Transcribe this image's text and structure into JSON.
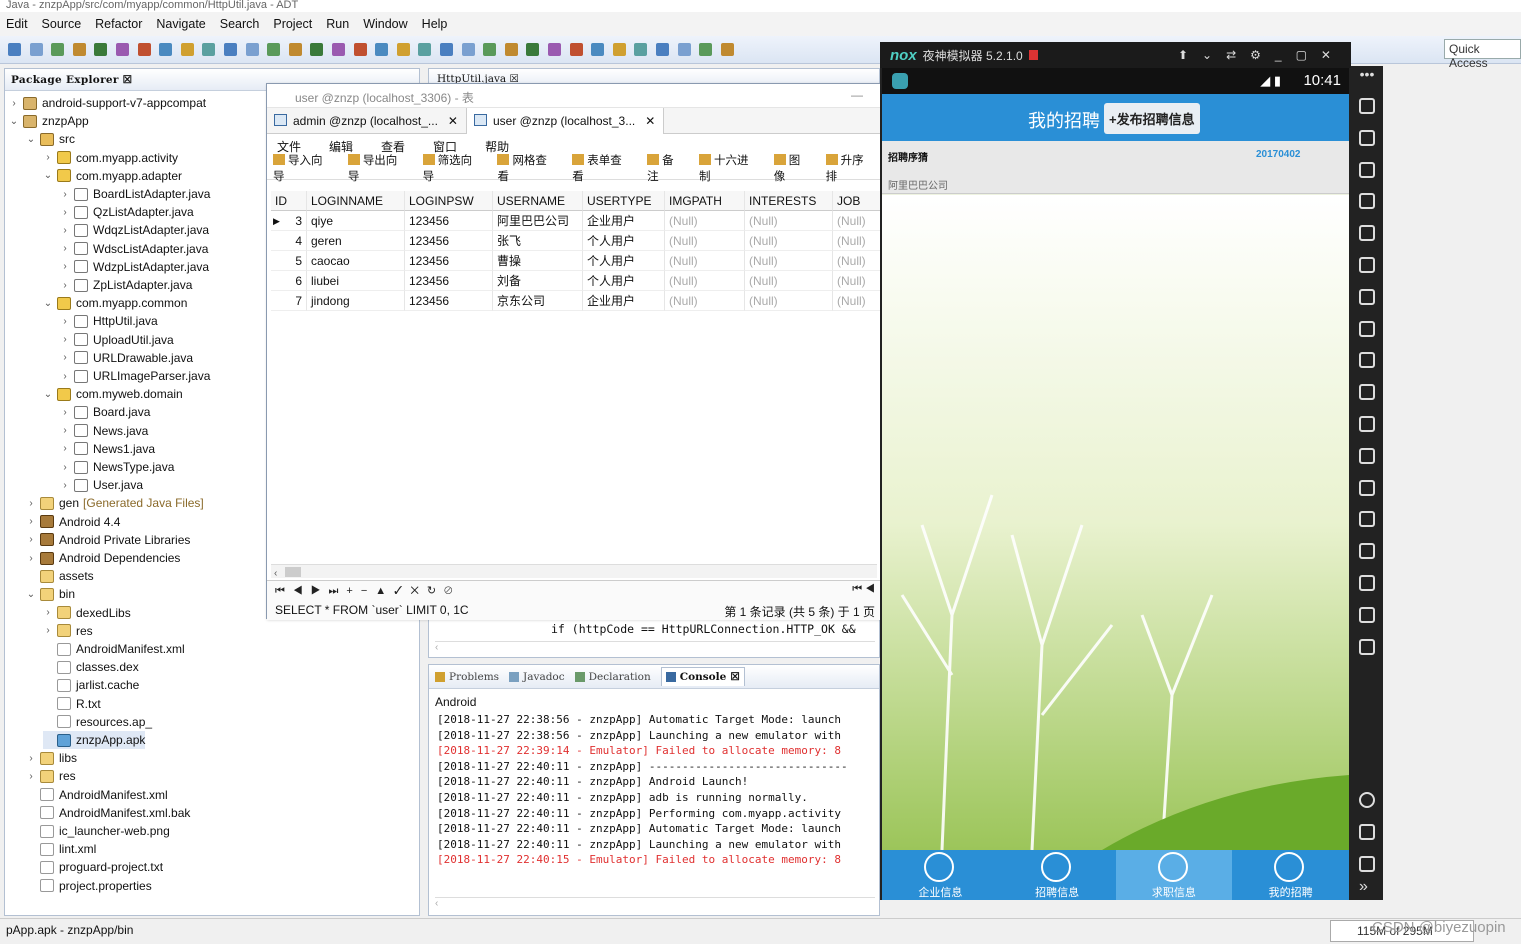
{
  "window": {
    "title": "Java - znzpApp/src/com/myapp/common/HttpUtil.java - ADT"
  },
  "menu": [
    "Edit",
    "Source",
    "Refactor",
    "Navigate",
    "Search",
    "Project",
    "Run",
    "Window",
    "Help"
  ],
  "quick_access": "Quick Access",
  "package_explorer": {
    "title": "Package Explorer",
    "rows": [
      {
        "label": "android-support-v7-appcompat",
        "depth": 0,
        "tw": "›",
        "icon": "proj"
      },
      {
        "label": "znzpApp",
        "depth": 0,
        "tw": "⌄",
        "icon": "proj"
      },
      {
        "label": "src",
        "depth": 1,
        "tw": "⌄",
        "icon": "src"
      },
      {
        "label": "com.myapp.activity",
        "depth": 2,
        "tw": "›",
        "icon": "pkg"
      },
      {
        "label": "com.myapp.adapter",
        "depth": 2,
        "tw": "⌄",
        "icon": "pkg"
      },
      {
        "label": "BoardListAdapter.java",
        "depth": 3,
        "tw": "›",
        "icon": "java"
      },
      {
        "label": "QzListAdapter.java",
        "depth": 3,
        "tw": "›",
        "icon": "java"
      },
      {
        "label": "WdqzListAdapter.java",
        "depth": 3,
        "tw": "›",
        "icon": "java"
      },
      {
        "label": "WdscListAdapter.java",
        "depth": 3,
        "tw": "›",
        "icon": "java"
      },
      {
        "label": "WdzpListAdapter.java",
        "depth": 3,
        "tw": "›",
        "icon": "java"
      },
      {
        "label": "ZpListAdapter.java",
        "depth": 3,
        "tw": "›",
        "icon": "java"
      },
      {
        "label": "com.myapp.common",
        "depth": 2,
        "tw": "⌄",
        "icon": "pkg"
      },
      {
        "label": "HttpUtil.java",
        "depth": 3,
        "tw": "›",
        "icon": "java"
      },
      {
        "label": "UploadUtil.java",
        "depth": 3,
        "tw": "›",
        "icon": "java"
      },
      {
        "label": "URLDrawable.java",
        "depth": 3,
        "tw": "›",
        "icon": "java"
      },
      {
        "label": "URLImageParser.java",
        "depth": 3,
        "tw": "›",
        "icon": "java"
      },
      {
        "label": "com.myweb.domain",
        "depth": 2,
        "tw": "⌄",
        "icon": "pkg"
      },
      {
        "label": "Board.java",
        "depth": 3,
        "tw": "›",
        "icon": "java"
      },
      {
        "label": "News.java",
        "depth": 3,
        "tw": "›",
        "icon": "java"
      },
      {
        "label": "News1.java",
        "depth": 3,
        "tw": "›",
        "icon": "java"
      },
      {
        "label": "NewsType.java",
        "depth": 3,
        "tw": "›",
        "icon": "java"
      },
      {
        "label": "User.java",
        "depth": 3,
        "tw": "›",
        "icon": "java"
      },
      {
        "label": "gen",
        "depth": 1,
        "tw": "›",
        "icon": "folder",
        "suffix": "[Generated Java Files]"
      },
      {
        "label": "Android 4.4",
        "depth": 1,
        "tw": "›",
        "icon": "lib"
      },
      {
        "label": "Android Private Libraries",
        "depth": 1,
        "tw": "›",
        "icon": "lib"
      },
      {
        "label": "Android Dependencies",
        "depth": 1,
        "tw": "›",
        "icon": "lib"
      },
      {
        "label": "assets",
        "depth": 1,
        "tw": "",
        "icon": "folder"
      },
      {
        "label": "bin",
        "depth": 1,
        "tw": "⌄",
        "icon": "folder"
      },
      {
        "label": "dexedLibs",
        "depth": 2,
        "tw": "›",
        "icon": "folder"
      },
      {
        "label": "res",
        "depth": 2,
        "tw": "›",
        "icon": "folder"
      },
      {
        "label": "AndroidManifest.xml",
        "depth": 2,
        "tw": "",
        "icon": "file"
      },
      {
        "label": "classes.dex",
        "depth": 2,
        "tw": "",
        "icon": "file"
      },
      {
        "label": "jarlist.cache",
        "depth": 2,
        "tw": "",
        "icon": "file"
      },
      {
        "label": "R.txt",
        "depth": 2,
        "tw": "",
        "icon": "file"
      },
      {
        "label": "resources.ap_",
        "depth": 2,
        "tw": "",
        "icon": "file"
      },
      {
        "label": "znzpApp.apk",
        "depth": 2,
        "tw": "",
        "icon": "apk",
        "selected": true
      },
      {
        "label": "libs",
        "depth": 1,
        "tw": "›",
        "icon": "folder"
      },
      {
        "label": "res",
        "depth": 1,
        "tw": "›",
        "icon": "folder"
      },
      {
        "label": "AndroidManifest.xml",
        "depth": 1,
        "tw": "",
        "icon": "file"
      },
      {
        "label": "AndroidManifest.xml.bak",
        "depth": 1,
        "tw": "",
        "icon": "file"
      },
      {
        "label": "ic_launcher-web.png",
        "depth": 1,
        "tw": "",
        "icon": "file"
      },
      {
        "label": "lint.xml",
        "depth": 1,
        "tw": "",
        "icon": "file"
      },
      {
        "label": "proguard-project.txt",
        "depth": 1,
        "tw": "",
        "icon": "file"
      },
      {
        "label": "project.properties",
        "depth": 1,
        "tw": "",
        "icon": "file"
      }
    ]
  },
  "editor": {
    "tab": "HttpUtil.java",
    "code_line": "if (httpCode == HttpURLConnection.HTTP_OK &&"
  },
  "db_window": {
    "title": "user @znzp (localhost_3306) - 表",
    "tabs": [
      "admin @znzp (localhost_...",
      "user @znzp (localhost_3..."
    ],
    "menu": [
      "文件",
      "编辑",
      "查看",
      "窗口",
      "帮助"
    ],
    "tools": [
      "导入向导",
      "导出向导",
      "筛选向导",
      "网格查看",
      "表单查看",
      "备注",
      "十六进制",
      "图像",
      "升序排"
    ],
    "columns": [
      "ID",
      "LOGINNAME",
      "LOGINPSW",
      "USERNAME",
      "USERTYPE",
      "IMGPATH",
      "INTERESTS",
      "JOB"
    ],
    "rows": [
      [
        "3",
        "qiye",
        "123456",
        "阿里巴巴公司",
        "企业用户",
        "(Null)",
        "(Null)",
        "(Null)"
      ],
      [
        "4",
        "geren",
        "123456",
        "张飞",
        "个人用户",
        "(Null)",
        "(Null)",
        "(Null)"
      ],
      [
        "5",
        "caocao",
        "123456",
        "曹操",
        "个人用户",
        "(Null)",
        "(Null)",
        "(Null)"
      ],
      [
        "6",
        "liubei",
        "123456",
        "刘备",
        "个人用户",
        "(Null)",
        "(Null)",
        "(Null)"
      ],
      [
        "7",
        "jindong",
        "123456",
        "京东公司",
        "企业用户",
        "(Null)",
        "(Null)",
        "(Null)"
      ]
    ],
    "sql": "SELECT * FROM `user` LIMIT 0, 1C",
    "record_info": "第 1 条记录 (共 5 条) 于 1 页"
  },
  "console": {
    "tabs": [
      "Problems",
      "Javadoc",
      "Declaration",
      "Console"
    ],
    "header": "Android",
    "lines": [
      {
        "text": "[2018-11-27 22:38:56 - znzpApp] Automatic Target Mode: launch",
        "err": false
      },
      {
        "text": "[2018-11-27 22:38:56 - znzpApp] Launching a new emulator with",
        "err": false
      },
      {
        "text": "[2018-11-27 22:39:14 - Emulator] Failed to allocate memory: 8",
        "err": true
      },
      {
        "text": "[2018-11-27 22:40:11 - znzpApp] ------------------------------",
        "err": false
      },
      {
        "text": "[2018-11-27 22:40:11 - znzpApp] Android Launch!",
        "err": false
      },
      {
        "text": "[2018-11-27 22:40:11 - znzpApp] adb is running normally.",
        "err": false
      },
      {
        "text": "[2018-11-27 22:40:11 - znzpApp] Performing com.myapp.activity",
        "err": false
      },
      {
        "text": "[2018-11-27 22:40:11 - znzpApp] Automatic Target Mode: launch",
        "err": false
      },
      {
        "text": "[2018-11-27 22:40:11 - znzpApp] Launching a new emulator with",
        "err": false
      },
      {
        "text": "[2018-11-27 22:40:15 - Emulator] Failed to allocate memory: 8",
        "err": true
      }
    ]
  },
  "emulator": {
    "brand": "nox",
    "title": "夜神模拟器 5.2.1.0",
    "time": "10:41",
    "app": {
      "title": "我的招聘",
      "publish_button": "+发布招聘信息",
      "list_header": "招聘序猜",
      "list_date": "20170402",
      "list_company": "阿里巴巴公司",
      "nav": [
        "企业信息",
        "招聘信息",
        "求职信息",
        "我的招聘"
      ]
    },
    "accent": "#2a8fd6"
  },
  "statusbar": {
    "left": "pApp.apk - znzpApp/bin",
    "right": "115M of 295M",
    "watermark": "CSDN @biyezuopin"
  }
}
